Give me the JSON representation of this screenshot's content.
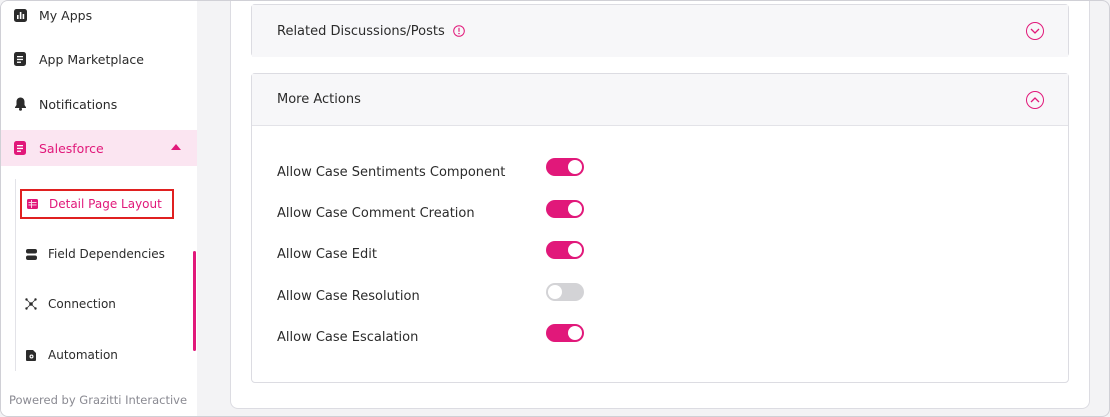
{
  "sidebar": {
    "items": [
      {
        "label": "My Apps",
        "icon": "bar-chart-icon"
      },
      {
        "label": "App Marketplace",
        "icon": "document-icon"
      },
      {
        "label": "Notifications",
        "icon": "bell-icon"
      },
      {
        "label": "Salesforce",
        "icon": "document-icon",
        "active": true,
        "expanded": true
      }
    ],
    "sub_items": [
      {
        "label": "Detail Page Layout",
        "icon": "table-icon",
        "selected": true
      },
      {
        "label": "Field Dependencies",
        "icon": "stack-icon"
      },
      {
        "label": "Connection",
        "icon": "hub-icon"
      },
      {
        "label": "Automation",
        "icon": "automation-icon"
      }
    ],
    "footer": "Powered by Grazitti Interactive"
  },
  "panels": {
    "related": {
      "title": "Related Discussions/Posts",
      "expanded": false
    },
    "more_actions": {
      "title": "More Actions",
      "expanded": true
    }
  },
  "toggles": [
    {
      "label": "Allow Case Sentiments Component",
      "on": true
    },
    {
      "label": "Allow Case Comment Creation",
      "on": true
    },
    {
      "label": "Allow Case Edit",
      "on": true
    },
    {
      "label": "Allow Case Resolution",
      "on": false
    },
    {
      "label": "Allow Case Escalation",
      "on": true
    }
  ],
  "colors": {
    "accent": "#e1187a",
    "active_bg": "#fbe5f1",
    "toggle_off": "#d3d3d6",
    "selection_outline": "#e02020"
  }
}
